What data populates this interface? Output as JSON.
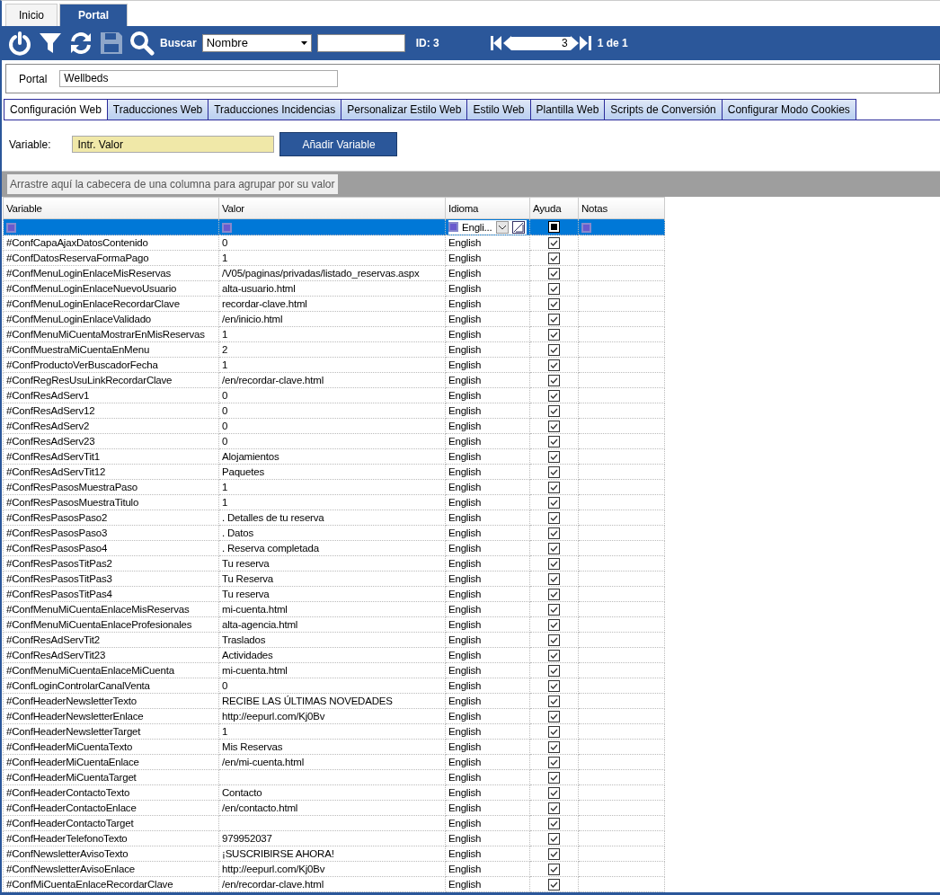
{
  "top_tabs": [
    {
      "label": "Inicio",
      "selected": false
    },
    {
      "label": "Portal",
      "selected": true
    }
  ],
  "toolbar": {
    "search_label": "Buscar",
    "search_field": "Nombre",
    "id_label": "ID: 3",
    "record": "3",
    "record_count": "1 de 1",
    "save_disabled": true
  },
  "portal": {
    "label": "Portal",
    "value": "Wellbeds"
  },
  "tabs": [
    {
      "label": "Configuración Web",
      "selected": true
    },
    {
      "label": "Traducciones Web",
      "selected": false
    },
    {
      "label": "Traducciones Incidencias",
      "selected": false
    },
    {
      "label": "Personalizar Estilo Web",
      "selected": false
    },
    {
      "label": "Estilo Web",
      "selected": false
    },
    {
      "label": "Plantilla Web",
      "selected": false
    },
    {
      "label": "Scripts de Conversión",
      "selected": false
    },
    {
      "label": "Configurar Modo Cookies",
      "selected": false
    }
  ],
  "variable_form": {
    "label": "Variable:",
    "placeholder": "Intr. Valor",
    "button": "Añadir Variable"
  },
  "group_panel": "Arrastre aquí la cabecera de una columna para agrupar por su valor",
  "table": {
    "columns": [
      "Variable",
      "Valor",
      "Idioma",
      "Ayuda",
      "Notas"
    ],
    "filter_language": "Engli...",
    "rows": [
      {
        "variable": "#ConfCapaAjaxDatosContenido",
        "valor": "0",
        "idioma": "English",
        "ayuda": true
      },
      {
        "variable": "#ConfDatosReservaFormaPago",
        "valor": "1",
        "idioma": "English",
        "ayuda": true
      },
      {
        "variable": "#ConfMenuLoginEnlaceMisReservas",
        "valor": "/V05/paginas/privadas/listado_reservas.aspx",
        "idioma": "English",
        "ayuda": true
      },
      {
        "variable": "#ConfMenuLoginEnlaceNuevoUsuario",
        "valor": "alta-usuario.html",
        "idioma": "English",
        "ayuda": true
      },
      {
        "variable": "#ConfMenuLoginEnlaceRecordarClave",
        "valor": "recordar-clave.html",
        "idioma": "English",
        "ayuda": true
      },
      {
        "variable": "#ConfMenuLoginEnlaceValidado",
        "valor": "/en/inicio.html",
        "idioma": "English",
        "ayuda": true
      },
      {
        "variable": "#ConfMenuMiCuentaMostrarEnMisReservas",
        "valor": "1",
        "idioma": "English",
        "ayuda": true
      },
      {
        "variable": "#ConfMuestraMiCuentaEnMenu",
        "valor": "2",
        "idioma": "English",
        "ayuda": true
      },
      {
        "variable": "#ConfProductoVerBuscadorFecha",
        "valor": "1",
        "idioma": "English",
        "ayuda": true
      },
      {
        "variable": "#ConfRegResUsuLinkRecordarClave",
        "valor": "/en/recordar-clave.html",
        "idioma": "English",
        "ayuda": true
      },
      {
        "variable": "#ConfResAdServ1",
        "valor": "0",
        "idioma": "English",
        "ayuda": true
      },
      {
        "variable": "#ConfResAdServ12",
        "valor": "0",
        "idioma": "English",
        "ayuda": true
      },
      {
        "variable": "#ConfResAdServ2",
        "valor": "0",
        "idioma": "English",
        "ayuda": true
      },
      {
        "variable": "#ConfResAdServ23",
        "valor": "0",
        "idioma": "English",
        "ayuda": true
      },
      {
        "variable": "#ConfResAdServTit1",
        "valor": "Alojamientos",
        "idioma": "English",
        "ayuda": true
      },
      {
        "variable": "#ConfResAdServTit12",
        "valor": "Paquetes",
        "idioma": "English",
        "ayuda": true
      },
      {
        "variable": "#ConfResPasosMuestraPaso",
        "valor": "1",
        "idioma": "English",
        "ayuda": true
      },
      {
        "variable": "#ConfResPasosMuestraTitulo",
        "valor": "1",
        "idioma": "English",
        "ayuda": true
      },
      {
        "variable": "#ConfResPasosPaso2",
        "valor": ". Detalles de tu reserva",
        "idioma": "English",
        "ayuda": true
      },
      {
        "variable": "#ConfResPasosPaso3",
        "valor": ". Datos",
        "idioma": "English",
        "ayuda": true
      },
      {
        "variable": "#ConfResPasosPaso4",
        "valor": ". Reserva completada",
        "idioma": "English",
        "ayuda": true
      },
      {
        "variable": "#ConfResPasosTitPas2",
        "valor": "Tu reserva",
        "idioma": "English",
        "ayuda": true
      },
      {
        "variable": "#ConfResPasosTitPas3",
        "valor": "Tu Reserva",
        "idioma": "English",
        "ayuda": true
      },
      {
        "variable": "#ConfResPasosTitPas4",
        "valor": "Tu reserva",
        "idioma": "English",
        "ayuda": true
      },
      {
        "variable": "#ConfMenuMiCuentaEnlaceMisReservas",
        "valor": "mi-cuenta.html",
        "idioma": "English",
        "ayuda": true
      },
      {
        "variable": "#ConfMenuMiCuentaEnlaceProfesionales",
        "valor": "alta-agencia.html",
        "idioma": "English",
        "ayuda": true
      },
      {
        "variable": "#ConfResAdServTit2",
        "valor": "Traslados",
        "idioma": "English",
        "ayuda": true
      },
      {
        "variable": "#ConfResAdServTit23",
        "valor": "Actividades",
        "idioma": "English",
        "ayuda": true
      },
      {
        "variable": "#ConfMenuMiCuentaEnlaceMiCuenta",
        "valor": "mi-cuenta.html",
        "idioma": "English",
        "ayuda": true
      },
      {
        "variable": "#ConfLoginControlarCanalVenta",
        "valor": "0",
        "idioma": "English",
        "ayuda": true
      },
      {
        "variable": "#ConfHeaderNewsletterTexto",
        "valor": "RECIBE LAS ÚLTIMAS NOVEDADES",
        "idioma": "English",
        "ayuda": true
      },
      {
        "variable": "#ConfHeaderNewsletterEnlace",
        "valor": "http://eepurl.com/Kj0Bv",
        "idioma": "English",
        "ayuda": true
      },
      {
        "variable": "#ConfHeaderNewsletterTarget",
        "valor": "1",
        "idioma": "English",
        "ayuda": true
      },
      {
        "variable": "#ConfHeaderMiCuentaTexto",
        "valor": "Mis Reservas",
        "idioma": "English",
        "ayuda": true
      },
      {
        "variable": "#ConfHeaderMiCuentaEnlace",
        "valor": "/en/mi-cuenta.html",
        "idioma": "English",
        "ayuda": true
      },
      {
        "variable": "#ConfHeaderMiCuentaTarget",
        "valor": "",
        "idioma": "English",
        "ayuda": true
      },
      {
        "variable": "#ConfHeaderContactoTexto",
        "valor": "Contacto",
        "idioma": "English",
        "ayuda": true
      },
      {
        "variable": "#ConfHeaderContactoEnlace",
        "valor": "/en/contacto.html",
        "idioma": "English",
        "ayuda": true
      },
      {
        "variable": "#ConfHeaderContactoTarget",
        "valor": "",
        "idioma": "English",
        "ayuda": true
      },
      {
        "variable": "#ConfHeaderTelefonoTexto",
        "valor": "979952037",
        "idioma": "English",
        "ayuda": true
      },
      {
        "variable": "#ConfNewsletterAvisoTexto",
        "valor": "¡SUSCRIBIRSE AHORA!",
        "idioma": "English",
        "ayuda": true
      },
      {
        "variable": "#ConfNewsletterAvisoEnlace",
        "valor": "http://eepurl.com/Kj0Bv",
        "idioma": "English",
        "ayuda": true
      },
      {
        "variable": "#ConfMiCuentaEnlaceRecordarClave",
        "valor": "/en/recordar-clave.html",
        "idioma": "English",
        "ayuda": true
      }
    ]
  }
}
